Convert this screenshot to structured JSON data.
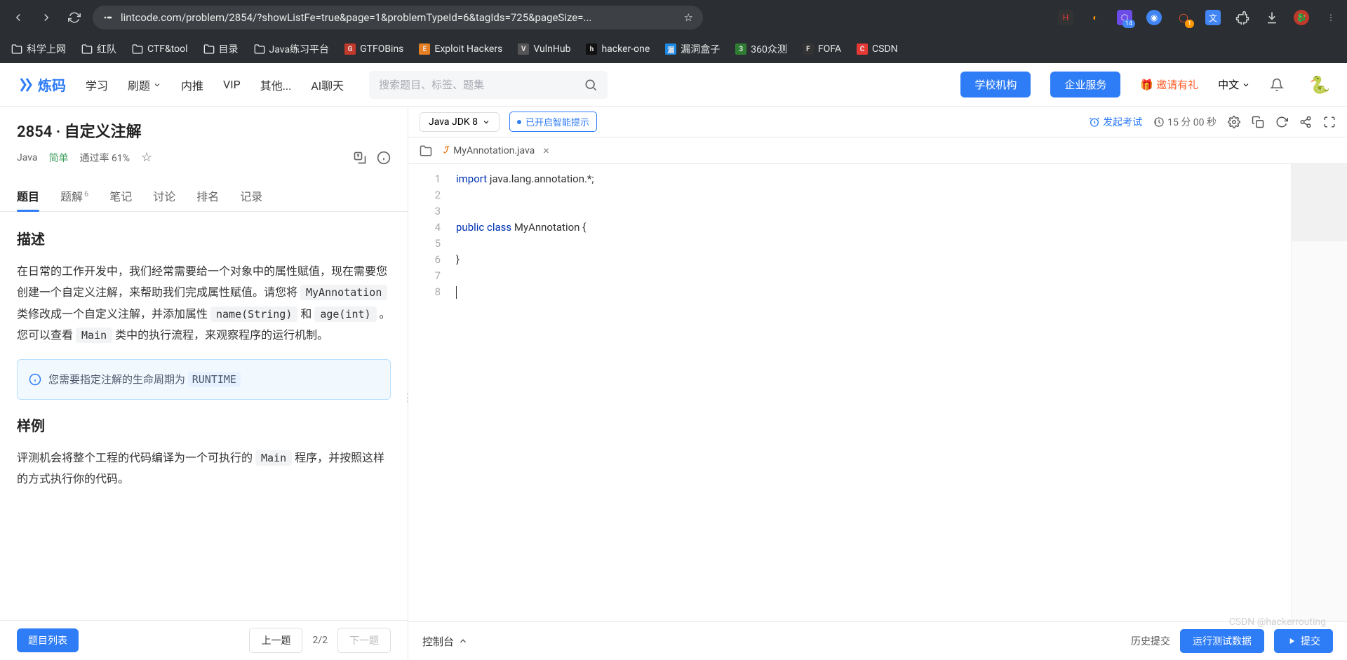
{
  "browser": {
    "url": "lintcode.com/problem/2854/?showListFe=true&page=1&problemTypeId=6&tagIds=725&pageSize=...",
    "ext_badges": {
      "purple": "14",
      "orange": "1"
    }
  },
  "bookmarks": [
    {
      "label": "科学上网",
      "type": "folder"
    },
    {
      "label": "红队",
      "type": "folder"
    },
    {
      "label": "CTF&tool",
      "type": "folder"
    },
    {
      "label": "目录",
      "type": "folder"
    },
    {
      "label": "Java练习平台",
      "type": "folder"
    },
    {
      "label": "GTFOBins",
      "type": "site",
      "color": "#c0392b"
    },
    {
      "label": "Exploit Hackers",
      "type": "site",
      "color": "#e67e22"
    },
    {
      "label": "VulnHub",
      "type": "site",
      "color": "#555"
    },
    {
      "label": "hacker-one",
      "type": "site",
      "color": "#111"
    },
    {
      "label": "漏洞盒子",
      "type": "site",
      "color": "#1e88e5"
    },
    {
      "label": "360众测",
      "type": "site",
      "color": "#2e7d32"
    },
    {
      "label": "FOFA",
      "type": "site",
      "color": "#333"
    },
    {
      "label": "CSDN",
      "type": "site",
      "color": "#e53935"
    }
  ],
  "header": {
    "brand": "炼码",
    "nav": [
      "学习",
      "刷题",
      "内推",
      "VIP",
      "其他...",
      "AI聊天"
    ],
    "search_placeholder": "搜索题目、标签、题集",
    "btn_school": "学校机构",
    "btn_enterprise": "企业服务",
    "invite": "邀请有礼",
    "lang": "中文"
  },
  "problem": {
    "title": "2854 · 自定义注解",
    "lang_tag": "Java",
    "difficulty": "简单",
    "pass_rate": "通过率 61%"
  },
  "tabs": [
    {
      "label": "题目",
      "active": true
    },
    {
      "label": "题解",
      "badge": "6"
    },
    {
      "label": "笔记"
    },
    {
      "label": "讨论"
    },
    {
      "label": "排名"
    },
    {
      "label": "记录"
    }
  ],
  "description": {
    "heading": "描述",
    "text_1": "在日常的工作开发中，我们经常需要给一个对象中的属性赋值，现在需要您创建一个自定义注解，来帮助我们完成属性赋值。请您将 ",
    "code_1": "MyAnnotation",
    "text_2": " 类修改成一个自定义注解，并添加属性 ",
    "code_2": "name(String)",
    "text_3": " 和 ",
    "code_3": "age(int)",
    "text_4": " 。您可以查看 ",
    "code_4": "Main",
    "text_5": " 类中的执行流程，来观察程序的运行机制。",
    "info_prefix": "您需要指定注解的生命周期为 ",
    "info_code": "RUNTIME",
    "example_heading": "样例",
    "example_1": "评测机会将整个工程的代码编译为一个可执行的 ",
    "example_code": "Main",
    "example_2": " 程序，并按照这样的方式执行你的代码。"
  },
  "left_bottom": {
    "list": "题目列表",
    "prev": "上一题",
    "page": "2/2",
    "next": "下一题"
  },
  "editor_bar": {
    "jdk": "Java JDK 8",
    "hint": "已开启智能提示",
    "exam": "发起考试",
    "timer": "15 分 00 秒"
  },
  "file": {
    "name": "MyAnnotation.java"
  },
  "code": {
    "lines": [
      {
        "n": 1,
        "segs": [
          [
            "kw",
            "import"
          ],
          [
            "",
            " java.lang.annotation.*;"
          ]
        ]
      },
      {
        "n": 2,
        "segs": []
      },
      {
        "n": 3,
        "segs": []
      },
      {
        "n": 4,
        "segs": [
          [
            "kw",
            "public"
          ],
          [
            "",
            " "
          ],
          [
            "kw",
            "class"
          ],
          [
            "",
            " MyAnnotation {"
          ]
        ]
      },
      {
        "n": 5,
        "segs": []
      },
      {
        "n": 6,
        "segs": [
          [
            "",
            "}"
          ]
        ]
      },
      {
        "n": 7,
        "segs": []
      },
      {
        "n": 8,
        "segs": [],
        "cursor": true
      }
    ]
  },
  "right_bottom": {
    "console": "控制台",
    "history": "历史提交",
    "run": "运行测试数据",
    "submit": "提交"
  },
  "watermark": "CSDN @hackerrouting"
}
